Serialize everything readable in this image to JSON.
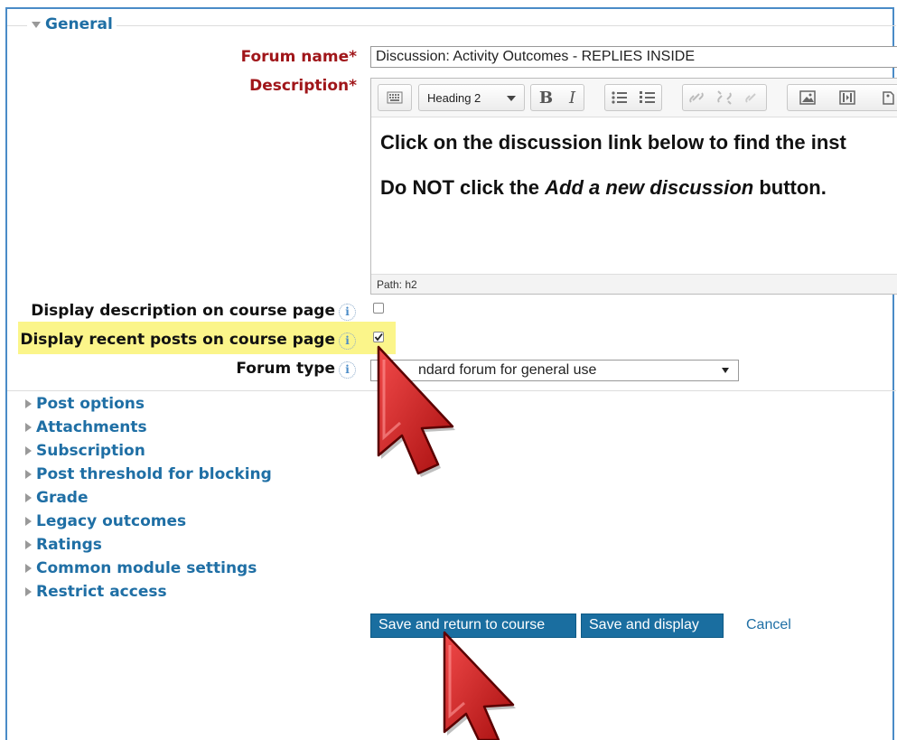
{
  "general": {
    "title": "General"
  },
  "forum_name": {
    "label": "Forum name",
    "required_mark": "*",
    "value": "Discussion: Activity Outcomes - REPLIES INSIDE"
  },
  "description": {
    "label": "Description",
    "required_mark": "*",
    "heading_select": "Heading 2",
    "line1": "Click on the discussion link below to find the inst",
    "line2_prefix": "Do NOT click the ",
    "line2_italic": "Add a new discussion",
    "line2_suffix": " button.",
    "path": "Path: h2"
  },
  "display_description": {
    "label": "Display description on course page",
    "checked": false
  },
  "display_recent_posts": {
    "label": "Display recent posts on course page",
    "checked": true,
    "highlight_color": "#fbf58a"
  },
  "forum_type": {
    "label": "Forum type",
    "value": "ndard forum for general use"
  },
  "help_glyph": "i",
  "sections": [
    "Post options",
    "Attachments",
    "Subscription",
    "Post threshold for blocking",
    "Grade",
    "Legacy outcomes",
    "Ratings",
    "Common module settings",
    "Restrict access"
  ],
  "buttons": {
    "save_return": "Save and return to course",
    "save_display": "Save and display",
    "cancel": "Cancel"
  },
  "colors": {
    "link": "#1f6fa5",
    "required": "#a0161a",
    "primary_button": "#1a6ea0",
    "cursor": "#cc1f1f"
  }
}
